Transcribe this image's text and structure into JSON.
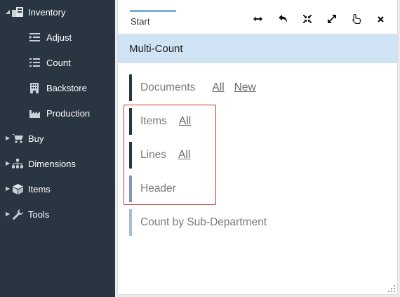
{
  "sidebar": {
    "items": [
      {
        "label": "Inventory",
        "icon": "inventory-icon",
        "expanded": true
      },
      {
        "label": "Adjust",
        "icon": "adjust-icon"
      },
      {
        "label": "Count",
        "icon": "count-list-icon"
      },
      {
        "label": "Backstore",
        "icon": "backstore-icon"
      },
      {
        "label": "Production",
        "icon": "production-icon"
      },
      {
        "label": "Buy",
        "icon": "cart-icon",
        "expanded": false
      },
      {
        "label": "Dimensions",
        "icon": "sitemap-icon",
        "expanded": false
      },
      {
        "label": "Items",
        "icon": "cube-icon",
        "expanded": false
      },
      {
        "label": "Tools",
        "icon": "wrench-icon",
        "expanded": false
      }
    ]
  },
  "panel": {
    "tab_label": "Start",
    "title": "Multi-Count",
    "toolbar": [
      "resize-horizontal-icon",
      "undo-icon",
      "compress-icon",
      "expand-icon",
      "pointer-hand-icon",
      "close-icon"
    ],
    "rows": {
      "documents": {
        "label": "Documents",
        "link_all": "All",
        "link_new": "New"
      },
      "items": {
        "label": "Items",
        "link_all": "All"
      },
      "lines": {
        "label": "Lines",
        "link_all": "All"
      },
      "header": {
        "label": "Header"
      },
      "count_sub": {
        "label": "Count by Sub-Department"
      }
    }
  },
  "colors": {
    "sidebar_bg": "#2a3542",
    "title_bar_bg": "#cfe3f4",
    "tab_accent": "#7aaedb",
    "highlight_border": "#c0392b"
  }
}
